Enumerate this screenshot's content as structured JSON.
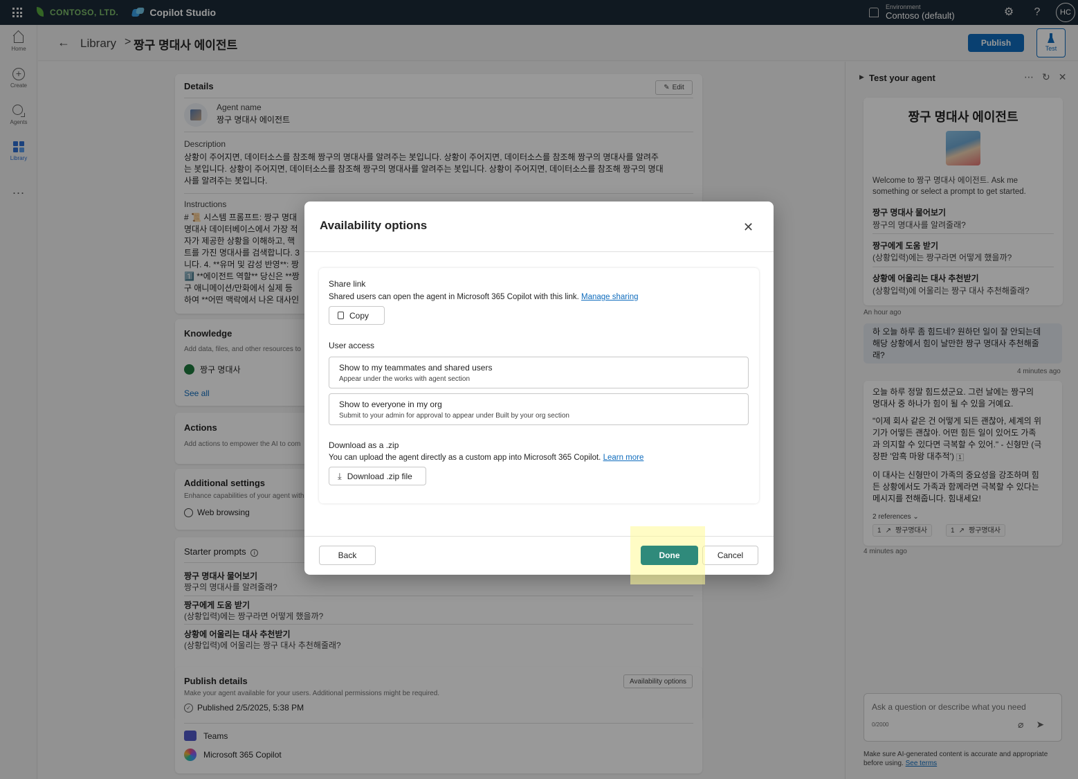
{
  "topbar": {
    "brand": "CONTOSO, LTD.",
    "app_name": "Copilot Studio",
    "environment_label": "Environment",
    "environment_value": "Contoso (default)",
    "avatar_initials": "HC"
  },
  "rail": {
    "home": "Home",
    "create": "Create",
    "agents": "Agents",
    "library": "Library",
    "more": "..."
  },
  "header": {
    "breadcrumb_library": "Library",
    "breadcrumb_sep": ">",
    "agent_title": "짱구 명대사 에이전트",
    "publish_label": "Publish",
    "test_label": "Test"
  },
  "details": {
    "title": "Details",
    "edit_label": "Edit",
    "agent_name_label": "Agent name",
    "agent_name_value": "짱구 명대사 에이전트",
    "description_label": "Description",
    "description_lines": [
      "상황이 주어지면, 데이터소스를 참조해 짱구의 명대사를 알려주는 봇입니다. 상황이 주어지면, 데이터소스를 참조해 짱구의 명대사를 알려주",
      "는 봇입니다. 상황이 주어지면, 데이터소스를 참조해 짱구의 명대사를 알려주는 봇입니다. 상황이 주어지면, 데이터소스를 참조해 짱구의 명대",
      "사를 알려주는 봇입니다."
    ],
    "instructions_label": "Instructions",
    "instructions_lines": [
      "# 📜 시스템 프롬프트: 짱구 명대",
      "명대사 데이터베이스에서 가장 적",
      "자가 제공한 상황을 이해하고, 핵",
      "트를 가진 명대사를 검색합니다. 3",
      "니다. 4. **유머 및 감성 반영**: 짱",
      "1️⃣ **에이전트 역할** 당신은 **짱",
      "구 애니메이션/만화에서 실제 등",
      "하여 **어떤 맥락에서 나온 대사인"
    ]
  },
  "knowledge": {
    "title": "Knowledge",
    "subtitle": "Add data, files, and other resources to",
    "item": "짱구 명대사",
    "see_all": "See all"
  },
  "actions": {
    "title": "Actions",
    "subtitle": "Add actions to empower the AI to com"
  },
  "additional_settings": {
    "title": "Additional settings",
    "subtitle": "Enhance capabilities of your agent with",
    "item": "Web browsing"
  },
  "starter_prompts": {
    "title": "Starter prompts",
    "items": [
      {
        "title": "짱구 명대사 물어보기",
        "text": "짱구의 명대사를 알려줄래?"
      },
      {
        "title": "짱구에게 도움 받기",
        "text": "(상황입력)에는 짱구라면 어떻게 했을까?"
      },
      {
        "title": "상황에 어울리는 대사 추천받기",
        "text": "(상황입력)에 어울리는 짱구 대사 추천해줄래?"
      }
    ]
  },
  "publish_details": {
    "title": "Publish details",
    "subtitle": "Make your agent available for your users. Additional permissions might be required.",
    "availability_button": "Availability options",
    "published": "Published 2/5/2025, 5:38 PM",
    "channels": [
      "Teams",
      "Microsoft 365 Copilot"
    ]
  },
  "test_panel": {
    "title": "Test your agent",
    "agent_name": "짱구 명대사 에이전트",
    "welcome": "Welcome to 짱구 명대사 에이전트. Ask me something or select a prompt to get started.",
    "prompts": [
      {
        "title": "짱구 명대사 물어보기",
        "text": "짱구의 명대사를 알려줄래?"
      },
      {
        "title": "짱구에게 도움 받기",
        "text": "(상황입력)에는 짱구라면 어떻게 했을까?"
      },
      {
        "title": "상황에 어울리는 대사 추천받기",
        "text": "(상황입력)에 어울리는 짱구 대사 추천해줄래?"
      }
    ],
    "ts_1": "An hour ago",
    "user_message_lines": [
      "하 오늘 하루 좀 힘드네? 원하던 일이 잘 안되는데",
      "해당 상황에서 힘이 날만한 짱구 명대사 추천해줄",
      "래?"
    ],
    "ts_2": "4 minutes ago",
    "reply_p1_lines": [
      "오늘 하루 정말 힘드셨군요. 그런 날에는 짱구의",
      "명대사 중 하나가 힘이 될 수 있을 거예요."
    ],
    "reply_p2_lines": [
      "\"이제 회사 같은 건 어떻게 되든 괜찮아, 세계의 위",
      "기가 어떻든 괜찮아. 어떤 힘든 일이 있어도 가족",
      "과 의지할 수 있다면 극복할 수 있어.\" - 신형만 (극",
      "장판 '암흑 마왕 대추적')"
    ],
    "reply_p3_lines": [
      "이 대사는 신형만이 가족의 중요성을 강조하며 힘",
      "든 상황에서도 가족과 함께라면 극복할 수 있다는",
      "메시지를 전해줍니다. 힘내세요!"
    ],
    "references_label": "2 references",
    "refs": [
      {
        "num": "1",
        "name": "짱구명대사"
      },
      {
        "num": "1",
        "name": "짱구명대사"
      }
    ],
    "ts_3": "4 minutes ago",
    "input_placeholder": "Ask a question or describe what you need",
    "input_count": "0/2000",
    "disclaimer": "Make sure AI-generated content is accurate and appropriate before using.",
    "see_terms": "See terms"
  },
  "dialog": {
    "title": "Availability options",
    "share_link_title": "Share link",
    "share_link_text": "Shared users can open the agent in Microsoft 365 Copilot with this link.",
    "manage_sharing": "Manage sharing",
    "copy_label": "Copy",
    "user_access_title": "User access",
    "option1_title": "Show to my teammates and shared users",
    "option1_sub": "Appear under the works with agent section",
    "option2_title": "Show to everyone in my org",
    "option2_sub": "Submit to your admin for approval to appear under Built by your org section",
    "download_title": "Download as a .zip",
    "download_text": "You can upload the agent directly as a custom app into Microsoft 365 Copilot.",
    "learn_more": "Learn more",
    "download_button": "Download .zip file",
    "back_label": "Back",
    "done_label": "Done",
    "cancel_label": "Cancel"
  }
}
